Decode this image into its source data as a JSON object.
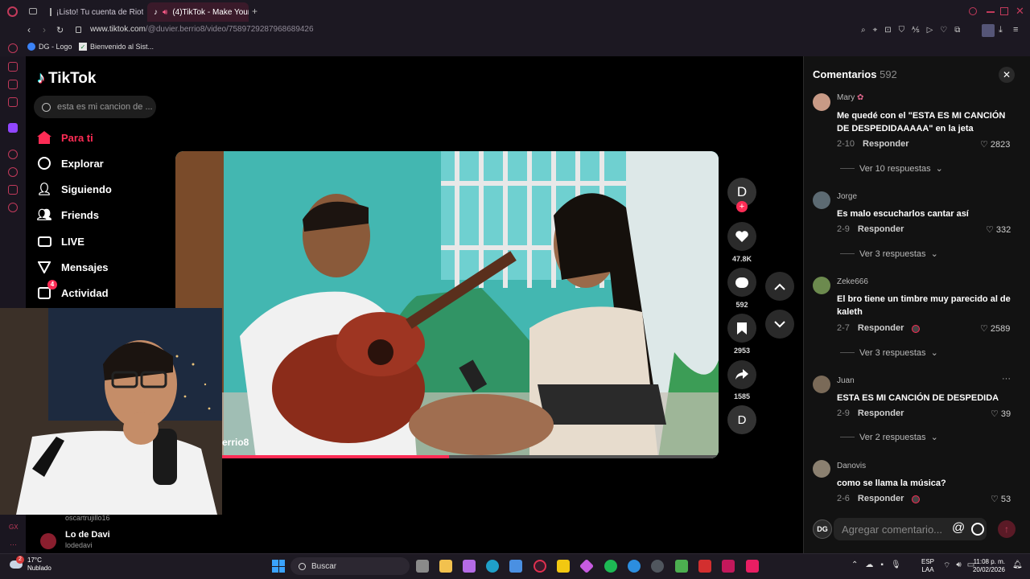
{
  "browser": {
    "tabs": [
      {
        "label": "¡Listo! Tu cuenta de Riot y..."
      },
      {
        "label": "(4)TikTok - Make Your..."
      }
    ],
    "url_domain": "www.tiktok.com",
    "url_path": "/@duvier.berrio8/video/7589729287968689426",
    "bookmarks": [
      "DG - Logo",
      "Bienvenido al Sist..."
    ]
  },
  "tiktok": {
    "logo": "TikTok",
    "search_placeholder": "esta es mi cancion de ...",
    "nav": [
      {
        "label": "Para ti",
        "icon": "home-icon",
        "active": true
      },
      {
        "label": "Explorar",
        "icon": "compass-icon"
      },
      {
        "label": "Siguiendo",
        "icon": "following-icon"
      },
      {
        "label": "Friends",
        "icon": "friends-icon"
      },
      {
        "label": "LIVE",
        "icon": "live-icon"
      },
      {
        "label": "Mensajes",
        "icon": "messages-icon"
      },
      {
        "label": "Actividad",
        "icon": "activity-icon",
        "badge": "4"
      }
    ],
    "video_username_partial": "errio8",
    "creator_avatar_letter": "D",
    "actions": {
      "likes": "47.8K",
      "comments": "592",
      "saves": "2953",
      "shares": "1585"
    },
    "following_accounts": [
      {
        "name": "oscartrujillo16"
      },
      {
        "name": "Lo de Davi",
        "handle": "lodedavi"
      }
    ]
  },
  "comments_panel": {
    "title": "Comentarios",
    "count": "592",
    "comments": [
      {
        "user": "Mary",
        "text": "Me quedé con el \"ESTA ES MI CANCIÓN DE DESPEDIDAAAAA\" en la jeta",
        "date": "2-10",
        "reply": "Responder",
        "likes": "2823",
        "more": "Ver 10 respuestas"
      },
      {
        "user": "Jorge",
        "text": "Es malo escucharlos cantar así",
        "date": "2-9",
        "reply": "Responder",
        "likes": "332",
        "more": "Ver 3 respuestas"
      },
      {
        "user": "Zeke666",
        "text": "El bro tiene un timbre muy parecido al de kaleth",
        "date": "2-7",
        "reply": "Responder",
        "likes": "2589",
        "more": "Ver 3 respuestas"
      },
      {
        "user": "Juan",
        "text": "ESTA ES MI CANCIÓN DE DESPEDIDA",
        "date": "2-9",
        "reply": "Responder",
        "likes": "39",
        "more": "Ver 2 respuestas"
      },
      {
        "user": "Danovis",
        "text": "como se llama la música?",
        "date": "2-6",
        "reply": "Responder",
        "likes": "53",
        "more": ""
      }
    ],
    "input_placeholder": "Agregar comentario...",
    "my_avatar": "DG"
  },
  "taskbar": {
    "weather_temp": "17°C",
    "weather_desc": "Nublado",
    "search_label": "Buscar",
    "lang_1": "ESP",
    "lang_2": "LAA",
    "time": "11:08 p. m.",
    "date": "20/02/2026",
    "notif_badge": "2"
  },
  "colors": {
    "accent": "#fe2c55",
    "browser": "#1c1822",
    "sidebar_accent": "#c23a5b"
  }
}
